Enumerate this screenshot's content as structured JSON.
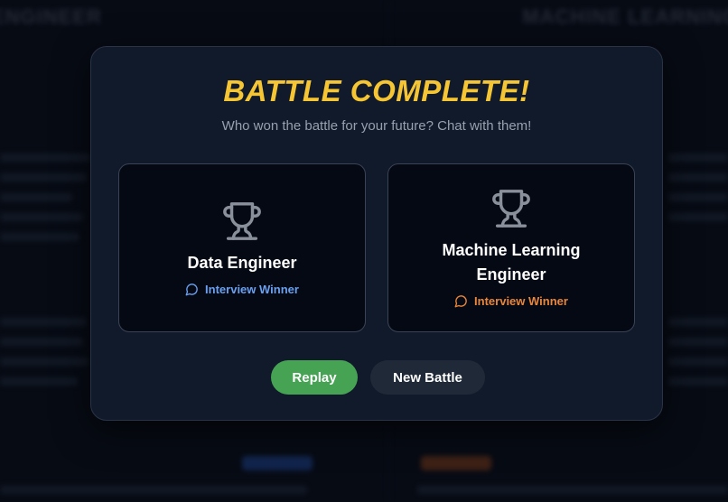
{
  "background": {
    "left_title": "ENGINEER",
    "right_title": "MACHINE LEARNING"
  },
  "modal": {
    "title": "BATTLE COMPLETE!",
    "subtitle": "Who won the battle for your future? Chat with them!"
  },
  "cards": [
    {
      "name": "Data Engineer",
      "badge": "Interview Winner",
      "icon": "trophy-icon",
      "badge_icon": "chat-bubble-icon",
      "badge_color": "#6aa0f0"
    },
    {
      "name": "Machine Learning Engineer",
      "badge": "Interview Winner",
      "icon": "trophy-icon",
      "badge_icon": "chat-bubble-icon",
      "badge_color": "#e9863a"
    }
  ],
  "buttons": {
    "replay": "Replay",
    "new_battle": "New Battle"
  },
  "colors": {
    "title": "#f5c534",
    "replay": "#45a353",
    "new_battle": "#1f2937"
  }
}
